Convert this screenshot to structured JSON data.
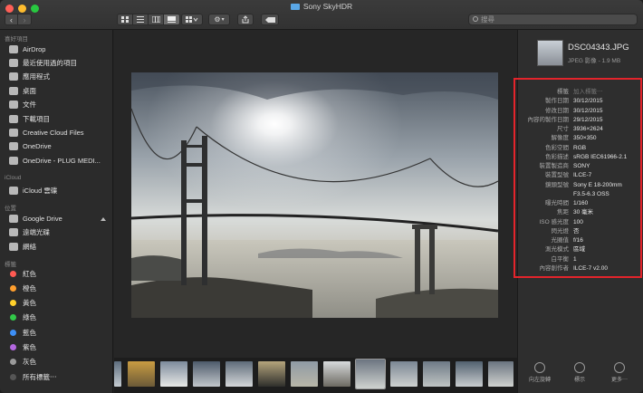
{
  "window": {
    "title": "Sony SkyHDR"
  },
  "toolbar": {
    "search_placeholder": "搜尋"
  },
  "sidebar": {
    "favorites_header": "喜好項目",
    "favorites": [
      "AirDrop",
      "最近使用過的項目",
      "應用程式",
      "桌面",
      "文件",
      "下載項目",
      "Creative Cloud Files",
      "OneDrive",
      "OneDrive - PLUG MEDI..."
    ],
    "icloud_header": "iCloud",
    "icloud": [
      "iCloud 雲碟"
    ],
    "locations_header": "位置",
    "locations": [
      "Google Drive",
      "遠端光碟",
      "網絡"
    ],
    "tags_header": "標籤",
    "tags": [
      {
        "label": "紅色",
        "color": "#ff5a52"
      },
      {
        "label": "橙色",
        "color": "#ff9f2e"
      },
      {
        "label": "黃色",
        "color": "#ffd02b"
      },
      {
        "label": "綠色",
        "color": "#32c949"
      },
      {
        "label": "藍色",
        "color": "#3d8ff6"
      },
      {
        "label": "紫色",
        "color": "#b468e0"
      },
      {
        "label": "灰色",
        "color": "#9a9a9a"
      },
      {
        "label": "所有標籤⋯",
        "color": "#555555"
      }
    ]
  },
  "info": {
    "filename": "DSC04343.JPG",
    "subtitle": "JPEG 影像 - 1.9 MB",
    "metadata": [
      {
        "k": "標籤",
        "v": "加入標籤⋯"
      },
      {
        "k": "製作日期",
        "v": "30/12/2015"
      },
      {
        "k": "修改日期",
        "v": "30/12/2015"
      },
      {
        "k": "內容的製作日期",
        "v": "29/12/2015"
      },
      {
        "k": "尺寸",
        "v": "3936×2624"
      },
      {
        "k": "解像度",
        "v": "350×350"
      },
      {
        "k": "色彩空間",
        "v": "RGB"
      },
      {
        "k": "色彩描述",
        "v": "sRGB IEC61966-2.1"
      },
      {
        "k": "裝置製造商",
        "v": "SONY"
      },
      {
        "k": "裝置型號",
        "v": "ILCE-7"
      },
      {
        "k": "鏡頭型號",
        "v": "Sony E 18-200mm"
      },
      {
        "k": "",
        "v": "F3.5-6.3 OSS"
      },
      {
        "k": "曝光時間",
        "v": "1/160"
      },
      {
        "k": "焦距",
        "v": "30 毫米"
      },
      {
        "k": "ISO 感光度",
        "v": "100"
      },
      {
        "k": "閃光燈",
        "v": "否"
      },
      {
        "k": "光圈值",
        "v": "f/16"
      },
      {
        "k": "測光模式",
        "v": "區域"
      },
      {
        "k": "白平衡",
        "v": "1"
      },
      {
        "k": "內容創作者",
        "v": "ILCE-7 v2.00"
      }
    ],
    "actions": [
      "向左旋轉",
      "標示",
      "更多⋯"
    ]
  },
  "colors": {
    "accent_red": "#e3242b",
    "highlight": "#e3242b"
  }
}
